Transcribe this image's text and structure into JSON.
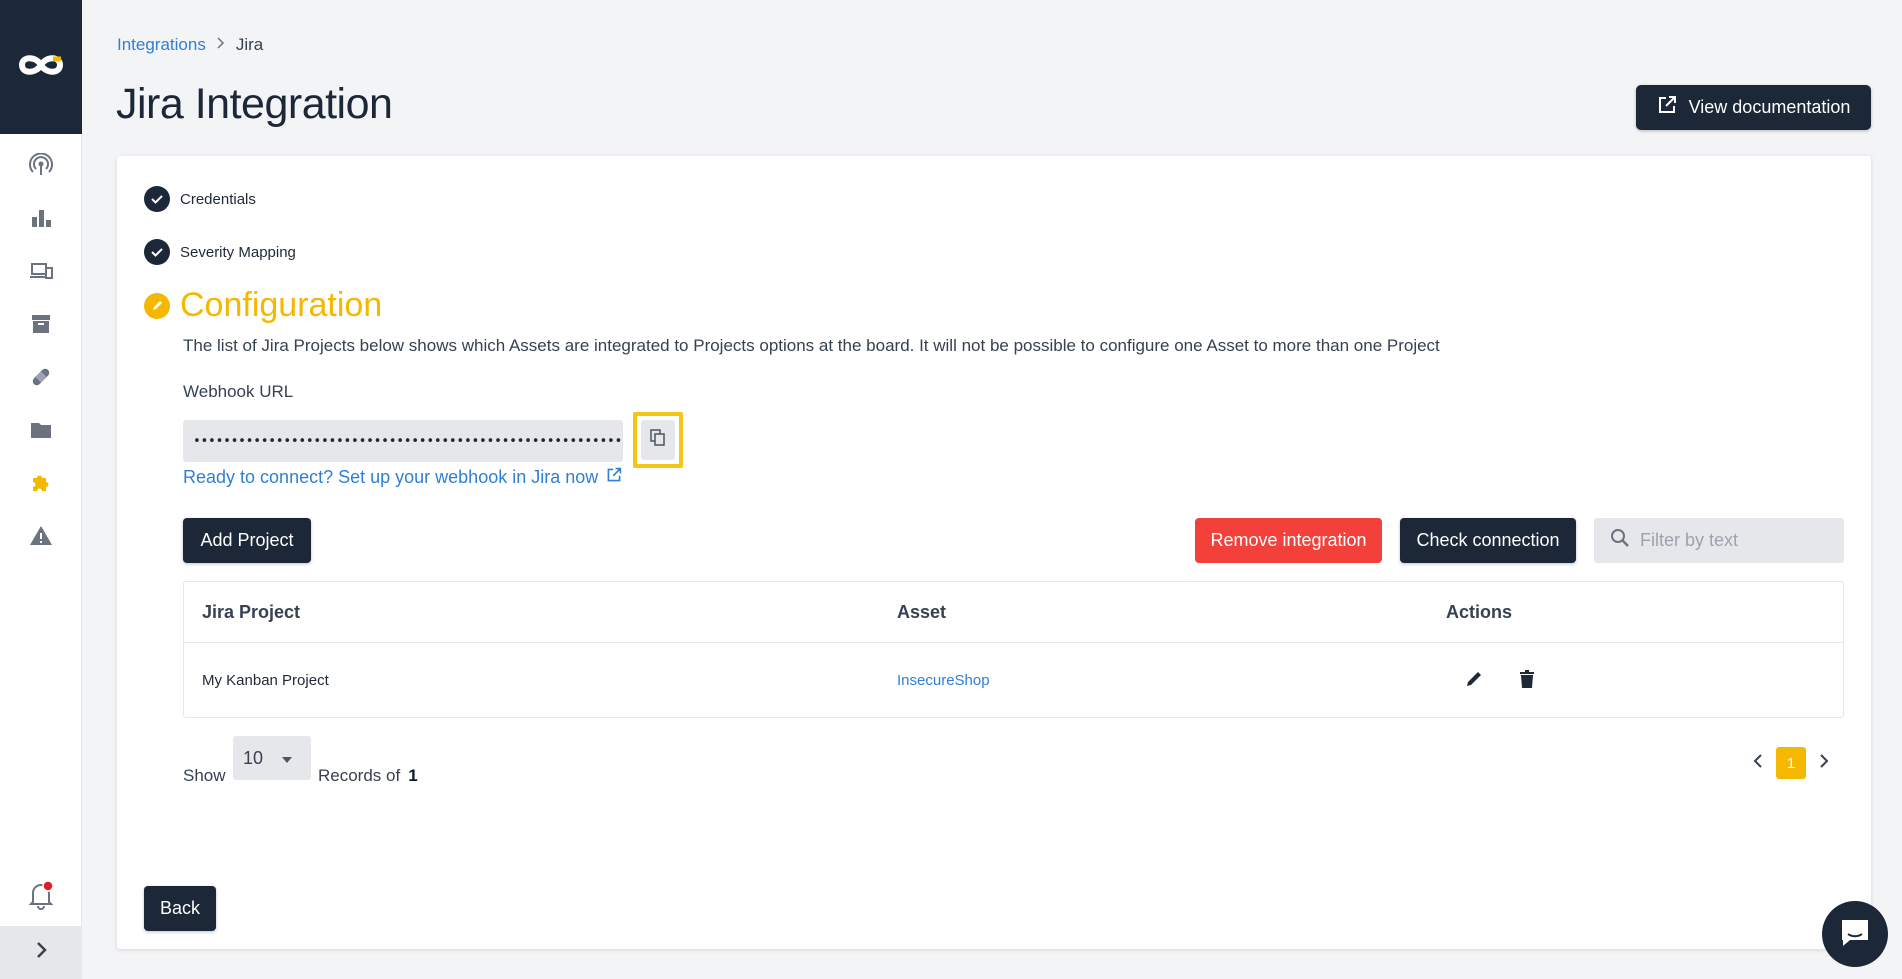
{
  "colors": {
    "brand_dark": "#1c2738",
    "accent": "#f5b800",
    "danger": "#f4403a",
    "link": "#2f7fd6"
  },
  "sidebar": {
    "logo_icon": "infinity-logo-icon",
    "items": [
      {
        "icon": "broadcast-icon"
      },
      {
        "icon": "bar-chart-icon"
      },
      {
        "icon": "devices-icon"
      },
      {
        "icon": "archive-icon"
      },
      {
        "icon": "bandage-icon"
      },
      {
        "icon": "folder-icon"
      },
      {
        "icon": "puzzle-icon",
        "active": true
      },
      {
        "icon": "warning-icon"
      }
    ],
    "notification_icon": "bell-icon",
    "expand_icon": "chevron-right-icon"
  },
  "breadcrumb": {
    "parent": "Integrations",
    "current": "Jira"
  },
  "header": {
    "title": "Jira Integration",
    "doc_button": "View documentation"
  },
  "steps": {
    "credentials": "Credentials",
    "severity": "Severity Mapping",
    "configuration": "Configuration"
  },
  "configuration": {
    "description": "The list of Jira Projects below shows which Assets are integrated to Projects options at the board. It will not be possible to configure one Asset to more than one Project",
    "webhook_label": "Webhook URL",
    "webhook_value": "•••••••••••••••••••••••••••••••••••••••••••••••••••••••••••••••••••••••••••",
    "webhook_link": "Ready to connect? Set up your webhook in Jira now"
  },
  "toolbar": {
    "add_project": "Add Project",
    "remove_integration": "Remove integration",
    "check_connection": "Check connection",
    "filter_placeholder": "Filter by text"
  },
  "table": {
    "columns": [
      "Jira Project",
      "Asset",
      "Actions"
    ],
    "rows": [
      {
        "project": "My Kanban Project",
        "asset": "InsecureShop"
      }
    ]
  },
  "pagination": {
    "show_label": "Show",
    "per_page": "10",
    "records_label": "Records of",
    "total": "1",
    "current_page": "1"
  },
  "footer": {
    "back_button": "Back"
  }
}
